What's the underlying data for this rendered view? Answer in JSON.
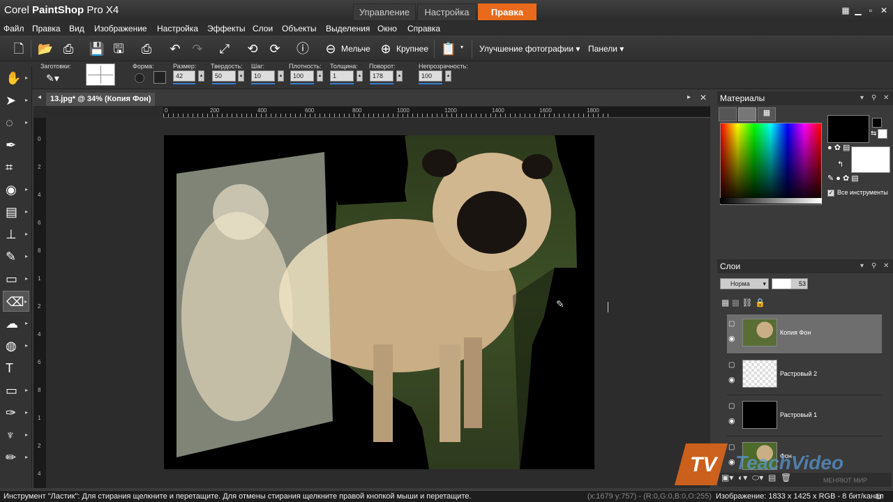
{
  "title": {
    "brand": "Corel",
    "product": "PaintShop",
    "version": "Pro X4"
  },
  "workspace_tabs": [
    {
      "label": "Управление"
    },
    {
      "label": "Настройка"
    },
    {
      "label": "Правка"
    }
  ],
  "menu": [
    "Файл",
    "Правка",
    "Вид",
    "Изображение",
    "Настройка",
    "Эффекты",
    "Слои",
    "Объекты",
    "Выделения",
    "Окно",
    "Справка"
  ],
  "toolbar": {
    "zoom_out": "Мельче",
    "zoom_in": "Крупнее",
    "enhance": "Улучшение фотографии",
    "panels": "Панели"
  },
  "tool_options": {
    "presets": "Заготовки:",
    "shape": "Форма:",
    "size": {
      "label": "Размер:",
      "value": "42"
    },
    "hardness": {
      "label": "Твердость:",
      "value": "50"
    },
    "step": {
      "label": "Шаг:",
      "value": "10"
    },
    "density": {
      "label": "Плотность:",
      "value": "100"
    },
    "thickness": {
      "label": "Толщина:",
      "value": "1"
    },
    "rotation": {
      "label": "Поворот:",
      "value": "178"
    },
    "opacity": {
      "label": "Непрозрачность:",
      "value": "100"
    }
  },
  "document": {
    "tab": "13.jpg* @  34% (Копия Фон)"
  },
  "ruler": {
    "h": [
      "0",
      "200",
      "400",
      "600",
      "800",
      "1000",
      "1200",
      "1400",
      "1600",
      "1800"
    ],
    "v": [
      "0",
      "2",
      "4",
      "6",
      "8",
      "1",
      "2",
      "4",
      "6",
      "8",
      "1",
      "2",
      "4"
    ]
  },
  "materials": {
    "title": "Материалы",
    "all_tools": "Все инструменты"
  },
  "layers": {
    "title": "Слои",
    "blend_mode": "Норма",
    "opacity": "53",
    "items": [
      {
        "name": "Копия Фон",
        "selected": true
      },
      {
        "name": "Растровый 2"
      },
      {
        "name": "Растровый 1"
      },
      {
        "name": "Фон"
      }
    ]
  },
  "watermark": {
    "brand": "TeachVideo",
    "tagline": "МЕНЯЮТ МИР"
  },
  "status": {
    "hint": "Инструмент \"Ластик\": Для стирания щелкните и перетащите. Для отмены стирания щелкните правой кнопкой мыши и перетащите.",
    "coords": "(x:1679 y:757) - (R:0,G:0,B:0,O:255)",
    "image": "Изображение:  1833 x 1425 x RGB - 8 бит/канал"
  },
  "colors": {
    "accent": "#e86a1a",
    "selection": "#3a7fd4"
  }
}
